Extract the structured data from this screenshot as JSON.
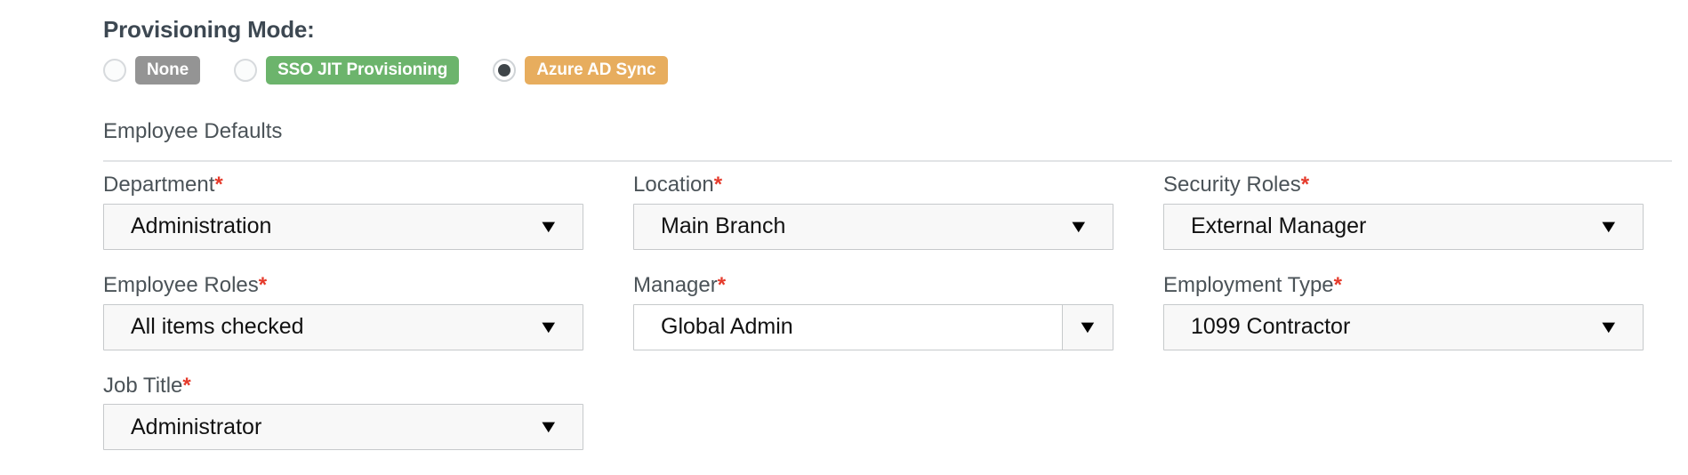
{
  "provisioning": {
    "title": "Provisioning Mode:",
    "options": [
      {
        "label": "None",
        "selected": false,
        "color": "#949494",
        "icon": "radio-unselected-icon"
      },
      {
        "label": "SSO JIT Provisioning",
        "selected": false,
        "color": "#6cb46c",
        "icon": "radio-unselected-icon"
      },
      {
        "label": "Azure AD Sync",
        "selected": true,
        "color": "#e7ad5e",
        "icon": "radio-selected-icon"
      }
    ]
  },
  "employee_defaults": {
    "section_title": "Employee Defaults",
    "required_marker": "*",
    "caret_glyph": "▼",
    "fields": [
      {
        "label": "Department",
        "required": true,
        "value": "Administration",
        "control": "select"
      },
      {
        "label": "Location",
        "required": true,
        "value": "Main Branch",
        "control": "select"
      },
      {
        "label": "Security Roles",
        "required": true,
        "value": "External Manager",
        "control": "select"
      },
      {
        "label": "Employee Roles",
        "required": true,
        "value": "All items checked",
        "control": "select"
      },
      {
        "label": "Manager",
        "required": true,
        "value": "Global Admin",
        "control": "combo"
      },
      {
        "label": "Employment Type",
        "required": true,
        "value": "1099 Contractor",
        "control": "select"
      },
      {
        "label": "Job Title",
        "required": true,
        "value": "Administrator",
        "control": "select"
      }
    ]
  }
}
